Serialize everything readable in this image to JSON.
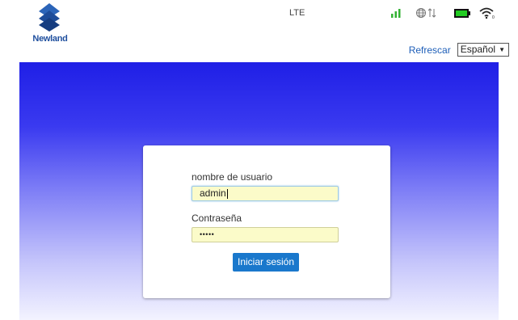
{
  "header": {
    "brand": "Newland",
    "network_type": "LTE",
    "icons": {
      "signal": "signal-strength-icon",
      "globe": "globe-data-icon",
      "battery": "battery-icon",
      "wifi": "wifi-icon"
    },
    "refresh_label": "Refrescar",
    "language": {
      "selected": "Español",
      "arrow": "▼"
    }
  },
  "login": {
    "username_label": "nombre de usuario",
    "username_value": "admin",
    "password_label": "Contraseña",
    "password_value": "•••••",
    "submit_label": "Iniciar sesión"
  },
  "colors": {
    "brand_blue": "#1f4f9e",
    "banner_top": "#1f1fe6",
    "button": "#1a78cc",
    "signal_green": "#33b233",
    "battery_green": "#22cc22"
  }
}
